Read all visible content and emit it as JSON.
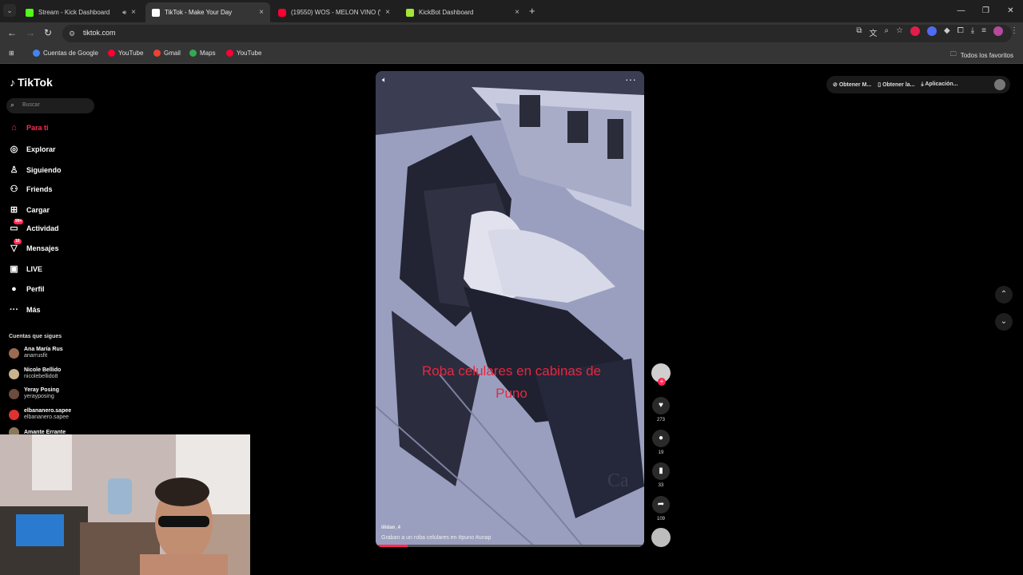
{
  "browser": {
    "tabs": [
      {
        "title": "Stream - Kick Dashboard",
        "favcolor": "#53fc18",
        "active": false,
        "audio": true
      },
      {
        "title": "TikTok - Make Your Day",
        "favcolor": "#ffffff",
        "active": true,
        "audio": false
      },
      {
        "title": "(19550) WOS - MELON VINO (\\",
        "favcolor": "#ff0033",
        "active": false,
        "audio": false
      },
      {
        "title": "KickBot Dashboard",
        "favcolor": "#a3e635",
        "active": false,
        "audio": false
      }
    ],
    "url": "tiktok.com",
    "bookmarks": [
      {
        "label": "Cuentas de Google",
        "color": "#4285f4"
      },
      {
        "label": "YouTube",
        "color": "#ff0033"
      },
      {
        "label": "Gmail",
        "color": "#ea4335"
      },
      {
        "label": "Maps",
        "color": "#34a853"
      },
      {
        "label": "YouTube",
        "color": "#ff0033"
      }
    ],
    "all_bookmarks": "Todos los favoritos"
  },
  "sidebar": {
    "logo": "TikTok",
    "search_placeholder": "Buscar",
    "nav": [
      {
        "label": "Para ti",
        "icon": "home-icon",
        "active": true
      },
      {
        "label": "Explorar",
        "icon": "compass-icon",
        "active": false
      },
      {
        "label": "Siguiendo",
        "icon": "following-icon",
        "active": false
      },
      {
        "label": "Friends",
        "icon": "friends-icon",
        "active": false
      },
      {
        "label": "Cargar",
        "icon": "upload-icon",
        "active": false
      },
      {
        "label": "Actividad",
        "icon": "activity-icon",
        "active": false,
        "badge": "99+"
      },
      {
        "label": "Mensajes",
        "icon": "messages-icon",
        "active": false,
        "badge": "10"
      },
      {
        "label": "LIVE",
        "icon": "live-icon",
        "active": false
      },
      {
        "label": "Perfil",
        "icon": "profile-icon",
        "active": false
      },
      {
        "label": "Más",
        "icon": "more-icon",
        "active": false
      }
    ],
    "following_header": "Cuentas que sigues",
    "accounts": [
      {
        "name": "Ana María Rus",
        "username": "anarrusfit"
      },
      {
        "name": "Nicole Bellido",
        "username": "nicolebellido8"
      },
      {
        "name": "Yeray Posing",
        "username": "yerayposing"
      },
      {
        "name": "elbananero.sapee",
        "username": "elbananero.sapee"
      },
      {
        "name": "Amante Errante",
        "username": ""
      }
    ]
  },
  "video": {
    "caption_overlay": "Roba celulares en cabinas de Puno",
    "author": "illidan_4",
    "description": "Graban a un roba celulares en #puno #unap",
    "progress": 0.12
  },
  "actions": {
    "likes": "273",
    "comments": "19",
    "saves": "33",
    "shares": "109"
  },
  "topbar": {
    "items": [
      "Obtener M...",
      "Obtener la...",
      "Aplicación..."
    ]
  }
}
